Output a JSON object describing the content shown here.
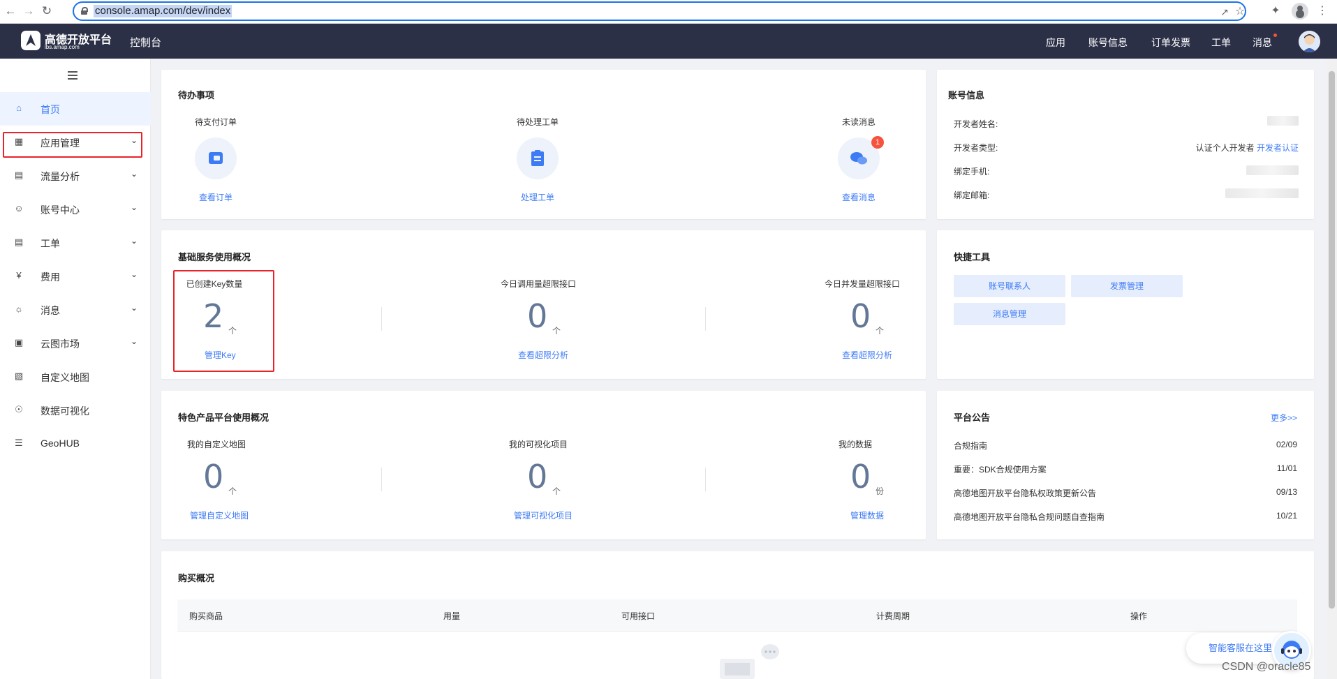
{
  "browser": {
    "url": "console.amap.com/dev/index",
    "back_icon": "arrow-left-icon",
    "forward_icon": "arrow-right-icon",
    "reload_icon": "reload-icon"
  },
  "header": {
    "logo_text": "高德开放平台",
    "logo_sub": "lbs.amap.com",
    "console_title": "控制台",
    "nav": [
      "应用",
      "账号信息",
      "订单发票",
      "工单",
      "消息"
    ]
  },
  "sidebar": {
    "items": [
      {
        "label": "首页",
        "icon": "home-icon",
        "active": true,
        "expandable": false
      },
      {
        "label": "应用管理",
        "icon": "grid-icon",
        "active": false,
        "expandable": true
      },
      {
        "label": "流量分析",
        "icon": "chart-icon",
        "active": false,
        "expandable": true
      },
      {
        "label": "账号中心",
        "icon": "user-icon",
        "active": false,
        "expandable": true
      },
      {
        "label": "工单",
        "icon": "ticket-icon",
        "active": false,
        "expandable": true
      },
      {
        "label": "费用",
        "icon": "yuan-icon",
        "active": false,
        "expandable": true
      },
      {
        "label": "消息",
        "icon": "message-icon",
        "active": false,
        "expandable": true
      },
      {
        "label": "云图市场",
        "icon": "store-icon",
        "active": false,
        "expandable": true
      },
      {
        "label": "自定义地图",
        "icon": "map-icon",
        "active": false,
        "expandable": false
      },
      {
        "label": "数据可视化",
        "icon": "visual-icon",
        "active": false,
        "expandable": false
      },
      {
        "label": "GeoHUB",
        "icon": "layers-icon",
        "active": false,
        "expandable": false
      }
    ]
  },
  "todo": {
    "title": "待办事项",
    "cols": [
      {
        "label": "待支付订单",
        "link": "查看订单",
        "icon": "wallet-icon"
      },
      {
        "label": "待处理工单",
        "link": "处理工单",
        "icon": "clipboard-icon"
      },
      {
        "label": "未读消息",
        "link": "查看消息",
        "icon": "chat-icon",
        "badge": "1"
      }
    ]
  },
  "account": {
    "title": "账号信息",
    "rows": [
      {
        "label": "开发者姓名:"
      },
      {
        "label": "开发者类型:",
        "value": "认证个人开发者",
        "link": "开发者认证"
      },
      {
        "label": "绑定手机:"
      },
      {
        "label": "绑定邮箱:"
      }
    ]
  },
  "basic": {
    "title": "基础服务使用概况",
    "cols": [
      {
        "label": "已创建Key数量",
        "value": "2",
        "unit": "个",
        "link": "管理Key"
      },
      {
        "label": "今日调用量超限接口",
        "value": "0",
        "unit": "个",
        "link": "查看超限分析"
      },
      {
        "label": "今日并发量超限接口",
        "value": "0",
        "unit": "个",
        "link": "查看超限分析"
      }
    ]
  },
  "tools": {
    "title": "快捷工具",
    "buttons": [
      "账号联系人",
      "发票管理",
      "消息管理"
    ]
  },
  "featured": {
    "title": "特色产品平台使用概况",
    "cols": [
      {
        "label": "我的自定义地图",
        "value": "0",
        "unit": "个",
        "link": "管理自定义地图"
      },
      {
        "label": "我的可视化项目",
        "value": "0",
        "unit": "个",
        "link": "管理可视化项目"
      },
      {
        "label": "我的数据",
        "value": "0",
        "unit": "份",
        "link": "管理数据"
      }
    ]
  },
  "notice": {
    "title": "平台公告",
    "more": "更多>>",
    "items": [
      {
        "text": "合规指南",
        "date": "02/09"
      },
      {
        "text": "重要：SDK合规使用方案",
        "date": "11/01"
      },
      {
        "text": "高德地图开放平台隐私权政策更新公告",
        "date": "09/13"
      },
      {
        "text": "高德地图开放平台隐私合规问题自查指南",
        "date": "10/21"
      }
    ]
  },
  "purchase": {
    "title": "购买概况",
    "columns": [
      "购买商品",
      "用量",
      "可用接口",
      "计费周期",
      "操作"
    ]
  },
  "help": {
    "label": "智能客服在这里"
  },
  "watermark": "CSDN @oracle85",
  "colors": {
    "accent": "#3d7bf5",
    "header": "#2b3047",
    "highlight": "#e8232b",
    "badge": "#f5533d"
  }
}
